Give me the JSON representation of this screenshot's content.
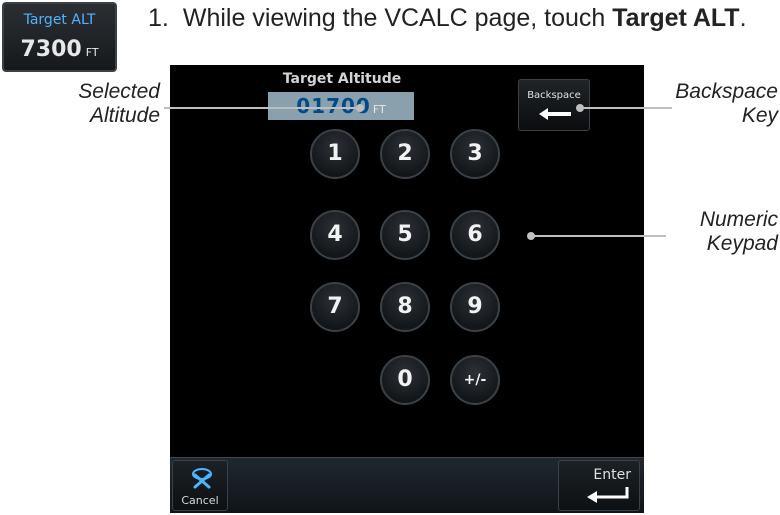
{
  "target_alt_key": {
    "label": "Target ALT",
    "value": "7300",
    "unit": "FT"
  },
  "instruction": {
    "number": "1.",
    "text_before": "While viewing the VCALC page, touch ",
    "bold": "Target ALT",
    "text_after": "."
  },
  "screen": {
    "title": "Target Altitude",
    "altitude_value": "01700",
    "altitude_unit": "FT",
    "backspace_label": "Backspace",
    "keypad": {
      "k1": "1",
      "k2": "2",
      "k3": "3",
      "k4": "4",
      "k5": "5",
      "k6": "6",
      "k7": "7",
      "k8": "8",
      "k9": "9",
      "k0": "0",
      "kpm": "+/-"
    },
    "cancel_label": "Cancel",
    "enter_label": "Enter"
  },
  "callouts": {
    "selected_altitude_1": "Selected",
    "selected_altitude_2": "Altitude",
    "backspace_key_1": "Backspace",
    "backspace_key_2": "Key",
    "numeric_keypad_1": "Numeric",
    "numeric_keypad_2": "Keypad"
  },
  "colors": {
    "accent_blue": "#4fb4ff",
    "screen_bg": "#000000",
    "field_bg": "#8aa0ac",
    "field_text": "#004a8a"
  }
}
